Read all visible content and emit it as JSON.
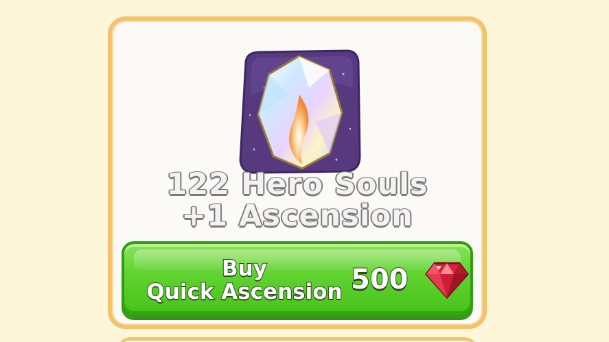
{
  "reward": {
    "line1": "122 Hero Souls",
    "line2": "+1 Ascension"
  },
  "buy_button": {
    "label_line1": "Buy",
    "label_line2": "Quick Ascension",
    "price": "500",
    "currency_icon": "ruby-icon"
  },
  "item_icon": "hero-soul-crystal-icon",
  "colors": {
    "background": "#fdf6d8",
    "card_border": "#f4c26a",
    "button_green": "#5fd22e",
    "icon_purple": "#5a3e8a",
    "ruby_red": "#d8243a"
  }
}
